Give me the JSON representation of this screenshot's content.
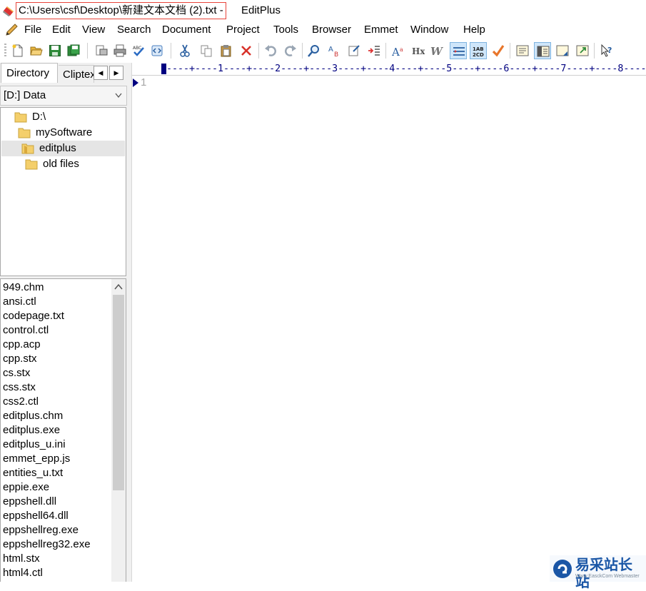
{
  "window": {
    "file_path": "C:\\Users\\csf\\Desktop\\新建文本文档 (2).txt -",
    "app_name": "EditPlus"
  },
  "menu": [
    "File",
    "Edit",
    "View",
    "Search",
    "Document",
    "Project",
    "Tools",
    "Browser",
    "Emmet",
    "Window",
    "Help"
  ],
  "toolbar": {
    "buttons": [
      "new-file-icon",
      "open-folder-icon",
      "save-icon",
      "save-all-icon",
      "print-preview-icon",
      "print-icon",
      "spell-check-icon",
      "browser-preview-icon",
      "cut-icon",
      "copy-icon",
      "paste-icon",
      "delete-icon",
      "undo-icon",
      "redo-icon",
      "find-icon",
      "replace-icon",
      "goto-icon",
      "indent-icon",
      "font-size-icon",
      "hex-icon",
      "word-wrap-icon",
      "line-number-toggle-icon",
      "column-number-icon",
      "check-icon",
      "output-window-icon",
      "cliptext-window-icon",
      "directory-window-icon",
      "full-screen-icon",
      "help-context-icon"
    ]
  },
  "left_panel": {
    "tabs": {
      "directory": "Directory",
      "cliptext": "Cliptext"
    },
    "drive": "[D:] Data",
    "tree": [
      {
        "label": "D:\\"
      },
      {
        "label": "mySoftware"
      },
      {
        "label": "editplus"
      },
      {
        "label": "old files"
      }
    ],
    "files": [
      "949.chm",
      "ansi.ctl",
      "codepage.txt",
      "control.ctl",
      "cpp.acp",
      "cpp.stx",
      "cs.stx",
      "css.stx",
      "css2.ctl",
      "editplus.chm",
      "editplus.exe",
      "editplus_u.ini",
      "emmet_epp.js",
      "entities_u.txt",
      "eppie.exe",
      "eppshell.dll",
      "eppshell64.dll",
      "eppshellreg.exe",
      "eppshellreg32.exe",
      "html.stx",
      "html4.ctl"
    ]
  },
  "editor": {
    "ruler": "----+----1----+----2----+----3----+----4----+----5----+----6----+----7----+----8----+----",
    "line_number": "1"
  },
  "watermark": {
    "text": "易采站长站",
    "sub": "Www.EasckCom Webmaster"
  },
  "colors": {
    "accent_navy": "#000080",
    "title_highlight": "#e8443a",
    "watermark_blue": "#1a56a6"
  }
}
